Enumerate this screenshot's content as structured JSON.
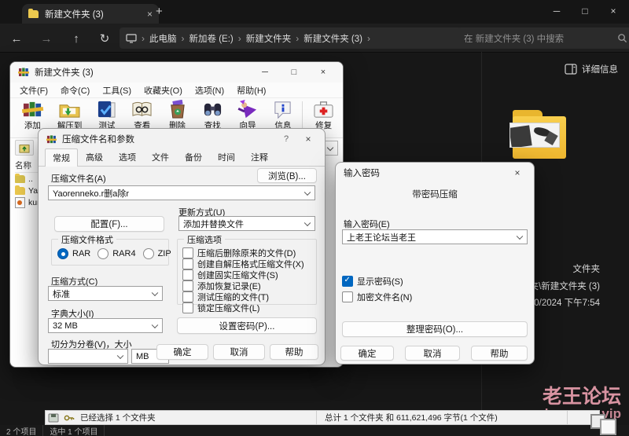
{
  "explorer": {
    "tab": {
      "title": "新建文件夹 (3)",
      "close_glyph": "×"
    },
    "new_tab_glyph": "+",
    "window_controls": {
      "minimize": "─",
      "maximize": "□",
      "close": "×"
    },
    "nav": {
      "back": "←",
      "forward": "→",
      "up": "↑",
      "refresh": "↻"
    },
    "breadcrumb": {
      "chevron": "›",
      "items": [
        "此电脑",
        "新加卷 (E:)",
        "新建文件夹",
        "新建文件夹 (3)"
      ]
    },
    "search": {
      "text": "在 新建文件夹 (3) 中搜索"
    },
    "details_toggle": "详细信息",
    "preview": {
      "type": "文件夹",
      "path": "新建文件夹\\新建文件夹 (3)",
      "modified": "18/10/2024 下午7:54"
    },
    "statusbar": {
      "items_count": "2 个项目",
      "selected": "选中 1 个项目"
    }
  },
  "winrar": {
    "title": "新建文件夹 (3)",
    "window_controls": {
      "minimize": "─",
      "maximize": "□",
      "close": "×"
    },
    "menus": [
      "文件(F)",
      "命令(C)",
      "工具(S)",
      "收藏夹(O)",
      "选项(N)",
      "帮助(H)"
    ],
    "toolbar": [
      {
        "icon": "add-icon",
        "label": "添加"
      },
      {
        "icon": "extract-icon",
        "label": "解压到"
      },
      {
        "icon": "test-icon",
        "label": "测试"
      },
      {
        "icon": "view-icon",
        "label": "查看"
      },
      {
        "icon": "delete-icon",
        "label": "删除"
      },
      {
        "icon": "find-icon",
        "label": "查找"
      },
      {
        "icon": "wizard-icon",
        "label": "向导"
      },
      {
        "icon": "info-icon",
        "label": "信息"
      },
      {
        "icon": "repair-icon",
        "label": "修复"
      }
    ],
    "list": {
      "column": "名称",
      "items": [
        {
          "name": ".."
        },
        {
          "name": "Yaor"
        },
        {
          "name": "kuma"
        }
      ]
    },
    "statusbar": {
      "selected": "已经选择 1 个文件夹",
      "total": "总计 1 个文件夹 和 611,621,496 字节(1 个文件)"
    }
  },
  "archive_dialog": {
    "title": "压缩文件名和参数",
    "help_glyph": "?",
    "close_glyph": "×",
    "tabs": [
      "常规",
      "高级",
      "选项",
      "文件",
      "备份",
      "时间",
      "注释"
    ],
    "active_tab": "常规",
    "archive_name_label": "压缩文件名(A)",
    "archive_name_value": "Yaorenneko.r删a除r",
    "browse_button": "浏览(B)...",
    "profiles_button": "配置(F)...",
    "update_mode_label": "更新方式(U)",
    "update_mode_value": "添加并替换文件",
    "format_group_label": "压缩文件格式",
    "formats": [
      {
        "label": "RAR",
        "selected": true
      },
      {
        "label": "RAR4",
        "selected": false
      },
      {
        "label": "ZIP",
        "selected": false
      }
    ],
    "method_label": "压缩方式(C)",
    "method_value": "标准",
    "dict_label": "字典大小(I)",
    "dict_value": "32 MB",
    "volume_label": "切分为分卷(V)，大小",
    "volume_value": "",
    "volume_unit": "MB",
    "options_group_label": "压缩选项",
    "options": [
      {
        "label": "压缩后删除原来的文件(D)",
        "checked": false
      },
      {
        "label": "创建自解压格式压缩文件(X)",
        "checked": false
      },
      {
        "label": "创建固实压缩文件(S)",
        "checked": false
      },
      {
        "label": "添加恢复记录(E)",
        "checked": false
      },
      {
        "label": "测试压缩的文件(T)",
        "checked": false
      },
      {
        "label": "锁定压缩文件(L)",
        "checked": false
      }
    ],
    "set_password_button": "设置密码(P)...",
    "buttons": {
      "ok": "确定",
      "cancel": "取消",
      "help": "帮助"
    }
  },
  "password_dialog": {
    "title": "输入密码",
    "close_glyph": "×",
    "heading": "带密码压缩",
    "input_label": "输入密码(E)",
    "input_value": "上老王论坛当老王",
    "show_password": {
      "label": "显示密码(S)",
      "checked": true
    },
    "encrypt_names": {
      "label": "加密文件名(N)",
      "checked": false
    },
    "organize_button": "整理密码(O)...",
    "buttons": {
      "ok": "确定",
      "cancel": "取消",
      "help": "帮助"
    }
  },
  "watermark": {
    "title": "老王论坛",
    "url": "laowang.vip",
    "color": "#d893a1"
  },
  "colors": {
    "accent": "#0067c0",
    "folder_yellow": "#f0bd3a",
    "explorer_bg": "#171717"
  }
}
